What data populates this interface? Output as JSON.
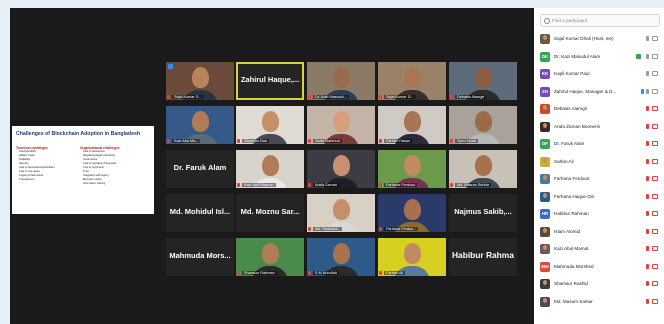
{
  "slide": {
    "title": "Challenges of Blockchain Adoption in Bangladesh",
    "technical_heading": "Technical challenges",
    "technical_items": [
      "Interoperability",
      "Hidden Costs",
      "Scalability",
      "Security",
      "Lack of developer/expert/talent",
      "Lack of use cases",
      "Legacy infrastructure",
      "Transparency"
    ],
    "organizational_heading": "Organizational challenges",
    "organizational_items": [
      "Lack of awareness",
      "Regulatory/legal uncertainty",
      "Governance",
      "Lack of regulatory framework",
      "Cost to implement",
      "Trust",
      "Integration with legacy",
      "Business model",
      "Information sharing"
    ]
  },
  "tiles": [
    {
      "type": "video",
      "name": "Sajal Kumar D...",
      "bg": "#6a4a3a",
      "skin": "#b8845c",
      "shirt": "#2a3344",
      "pinned": true,
      "muted": true
    },
    {
      "type": "nameonly",
      "name": "Zahirul Haque,...",
      "active": true
    },
    {
      "type": "video",
      "name": "Dr. Kazi Masudul...",
      "bg": "#8a7a66",
      "skin": "#9a6a4a",
      "shirt": "#2e3e5a",
      "muted": true
    },
    {
      "type": "video",
      "name": "Sajal Kumar D...",
      "bg": "#9a8268",
      "skin": "#a87650",
      "shirt": "#3a2e28",
      "muted": true
    },
    {
      "type": "video",
      "name": "Debasis Alamgir",
      "bg": "#5e6b7a",
      "skin": "#8c5d42",
      "shirt": "#2b2b2b",
      "muted": true
    },
    {
      "type": "video",
      "name": "Kazi Abu Ma...",
      "bg": "#355a8a",
      "skin": "#b07c58",
      "shirt": "#5a6a78",
      "muted": true
    },
    {
      "type": "video",
      "name": "Dipanjan Das",
      "bg": "#e0dcd4",
      "skin": "#c49068",
      "shirt": "#4a4a52",
      "muted": true
    },
    {
      "type": "video",
      "name": "Safat Mahmud",
      "bg": "#c4b5a8",
      "skin": "#d6a07c",
      "shirt": "#7a3a3a",
      "muted": true
    },
    {
      "type": "video",
      "name": "Farhan Hasan",
      "bg": "#cfcac4",
      "skin": "#a87454",
      "shirt": "#2a2a3a",
      "muted": true
    },
    {
      "type": "video",
      "name": "Syed Hasib",
      "bg": "#a8a29a",
      "skin": "#9c6a48",
      "shirt": "#b8b8b8",
      "muted": true
    },
    {
      "type": "nameonly",
      "name": "Dr. Faruk Alam"
    },
    {
      "type": "video",
      "name": "Kazi Abul Mamun",
      "bg": "#d8d4cc",
      "skin": "#b07c58",
      "shirt": "#e8e8e8",
      "muted": true
    },
    {
      "type": "video",
      "name": "Arafa Zaman",
      "bg": "#3c3c44",
      "skin": "#c89070",
      "shirt": "#1e1e26",
      "muted": true
    },
    {
      "type": "video",
      "name": "Farhana Ferdous",
      "bg": "#6a9a4a",
      "skin": "#c08a62",
      "shirt": "#7a3050",
      "muted": true
    },
    {
      "type": "video",
      "name": "Md. Masum Sarkar",
      "bg": "#c8c2b6",
      "skin": "#a8704c",
      "shirt": "#3a4a5a",
      "muted": true
    },
    {
      "type": "nameonly",
      "name": "Md. Mohidul Isl..."
    },
    {
      "type": "nameonly",
      "name": "Md. Moznu Sar..."
    },
    {
      "type": "video",
      "name": "Md. Rashidul...",
      "bg": "#d8d0c4",
      "skin": "#c49068",
      "shirt": "#d8d8d8",
      "muted": true
    },
    {
      "type": "video",
      "name": "Farhana Ferdou...",
      "bg": "#2a3a6a",
      "skin": "#a8704c",
      "shirt": "#8a6a30",
      "muted": true
    },
    {
      "type": "nameonly",
      "name": "Najmus Sakib,..."
    },
    {
      "type": "nameonly",
      "name": "Mahmuda Mors..."
    },
    {
      "type": "video",
      "name": "Shamsur Rahman",
      "bg": "#4a8a4a",
      "skin": "#b07c58",
      "shirt": "#2a2a2a",
      "muted": true
    },
    {
      "type": "video",
      "name": "S M Nurullah",
      "bg": "#2e5a8a",
      "skin": "#a87250",
      "shirt": "#2a2a2a",
      "muted": true
    },
    {
      "type": "video",
      "name": "Farhan Ali",
      "bg": "#d8d020",
      "skin": "#c08a62",
      "shirt": "#5a7a9a",
      "muted": true
    },
    {
      "type": "nameonly",
      "name": "Habibur Rahman",
      "big": true
    }
  ],
  "panel": {
    "search_placeholder": "Find a participant",
    "participants": [
      {
        "name": "Sajal Kumar Dhali (Host, me)",
        "avatar": "photo",
        "color": "#6a5a4a",
        "mic": "on",
        "cam": "on"
      },
      {
        "name": "Dr. Kazi Masudul Alam",
        "avatar": "DK",
        "color": "#2fa84f",
        "mic": "on",
        "cam": "on",
        "hand": true
      },
      {
        "name": "Kapil Kumar Paul",
        "avatar": "KK",
        "color": "#7a4ab8",
        "mic": "on",
        "cam": "on"
      },
      {
        "name": "Zahirul Haque, Manager & D...",
        "avatar": "ZH",
        "color": "#7a4ab8",
        "mic": "on",
        "cam": "on",
        "blue": true
      },
      {
        "name": "Debasis Alamgir",
        "avatar": "photo",
        "color": "#c84a2a",
        "mic": "off",
        "cam": "off"
      },
      {
        "name": "Arafa Zaman Bonnerin",
        "avatar": "photo",
        "color": "#3a2a2a",
        "mic": "off",
        "cam": "off"
      },
      {
        "name": "Dr. Faruk Alam",
        "avatar": "DF",
        "color": "#2fa84f",
        "mic": "off",
        "cam": "off"
      },
      {
        "name": "Sarfan Ali",
        "avatar": "photo",
        "color": "#c8b030",
        "mic": "off",
        "cam": "off"
      },
      {
        "name": "Farhana Ferdous",
        "avatar": "photo",
        "color": "#4a7a9a",
        "mic": "off",
        "cam": "off"
      },
      {
        "name": "Farhana Haque Ovi",
        "avatar": "photo",
        "color": "#2a5a8a",
        "mic": "off",
        "cam": "off"
      },
      {
        "name": "Habibur Rahman",
        "avatar": "HR",
        "color": "#3a6ac8",
        "mic": "off",
        "cam": "off"
      },
      {
        "name": "Islam Alomid",
        "avatar": "photo",
        "color": "#5a4a3a",
        "mic": "off",
        "cam": "off"
      },
      {
        "name": "Kazi Abul Mamat",
        "avatar": "photo",
        "color": "#6a5a5a",
        "mic": "off",
        "cam": "off"
      },
      {
        "name": "Mahmuda Morshed",
        "avatar": "MM",
        "color": "#e04a3a",
        "mic": "off",
        "cam": "off"
      },
      {
        "name": "Shamsur Rashid",
        "avatar": "photo",
        "color": "#3a3a3a",
        "mic": "off",
        "cam": "off"
      },
      {
        "name": "Md. Masum Sarkar",
        "avatar": "photo",
        "color": "#4a4a5a",
        "mic": "off",
        "cam": "off"
      }
    ]
  }
}
